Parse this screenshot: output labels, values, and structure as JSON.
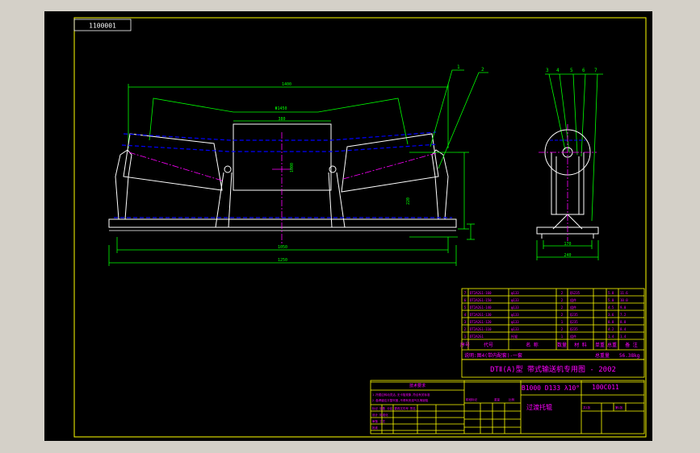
{
  "drawing": {
    "code_box": "1100001",
    "title_line": "DTⅡ(A)型  带式输送机专用图 - 2002",
    "spec": "B1000  D133 λ10°",
    "drawing_no": "100C011",
    "part_name": "过渡托辊",
    "tech_req_title": "技术要求",
    "total_weight_label": "总重量",
    "total_weight_value": "56.38kg",
    "bom_headers": [
      "序号",
      "代号",
      "名 称",
      "数量",
      "材 料",
      "单重",
      "总重",
      "备 注"
    ],
    "balloons_front": [
      "1",
      "2"
    ],
    "balloons_side": [
      "3",
      "4",
      "5",
      "6",
      "7"
    ]
  },
  "colors": {
    "frame": "#ffff00",
    "outline": "#ffffff",
    "dimension": "#00ff00",
    "center": "#ff00ff",
    "hidden": "#0000ff"
  }
}
